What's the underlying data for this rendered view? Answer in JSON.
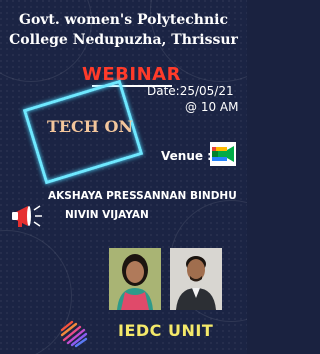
{
  "poster": {
    "college_line1": "Govt. women's Polytechnic",
    "college_line2": "College Nedupuzha, Thrissur",
    "event_type": "WEBINAR",
    "event_name": "TECH ON",
    "date": "Date:25/05/21",
    "time": "@ 10 AM",
    "venue_label": "Venue :",
    "venue_icon": "google-meet-icon",
    "speaker_1": "AKSHAYA PRESSANNAN BINDHU",
    "speaker_2": "NIVIN VIJAYAN",
    "organizer": "IEDC UNIT"
  },
  "colors": {
    "background": "#1b2444",
    "title": "#ffffff",
    "webinar": "#ff3b2a",
    "neon_box": "#6fe8ff",
    "tech_on": "#f3c69c",
    "organizer": "#f4e96a"
  }
}
